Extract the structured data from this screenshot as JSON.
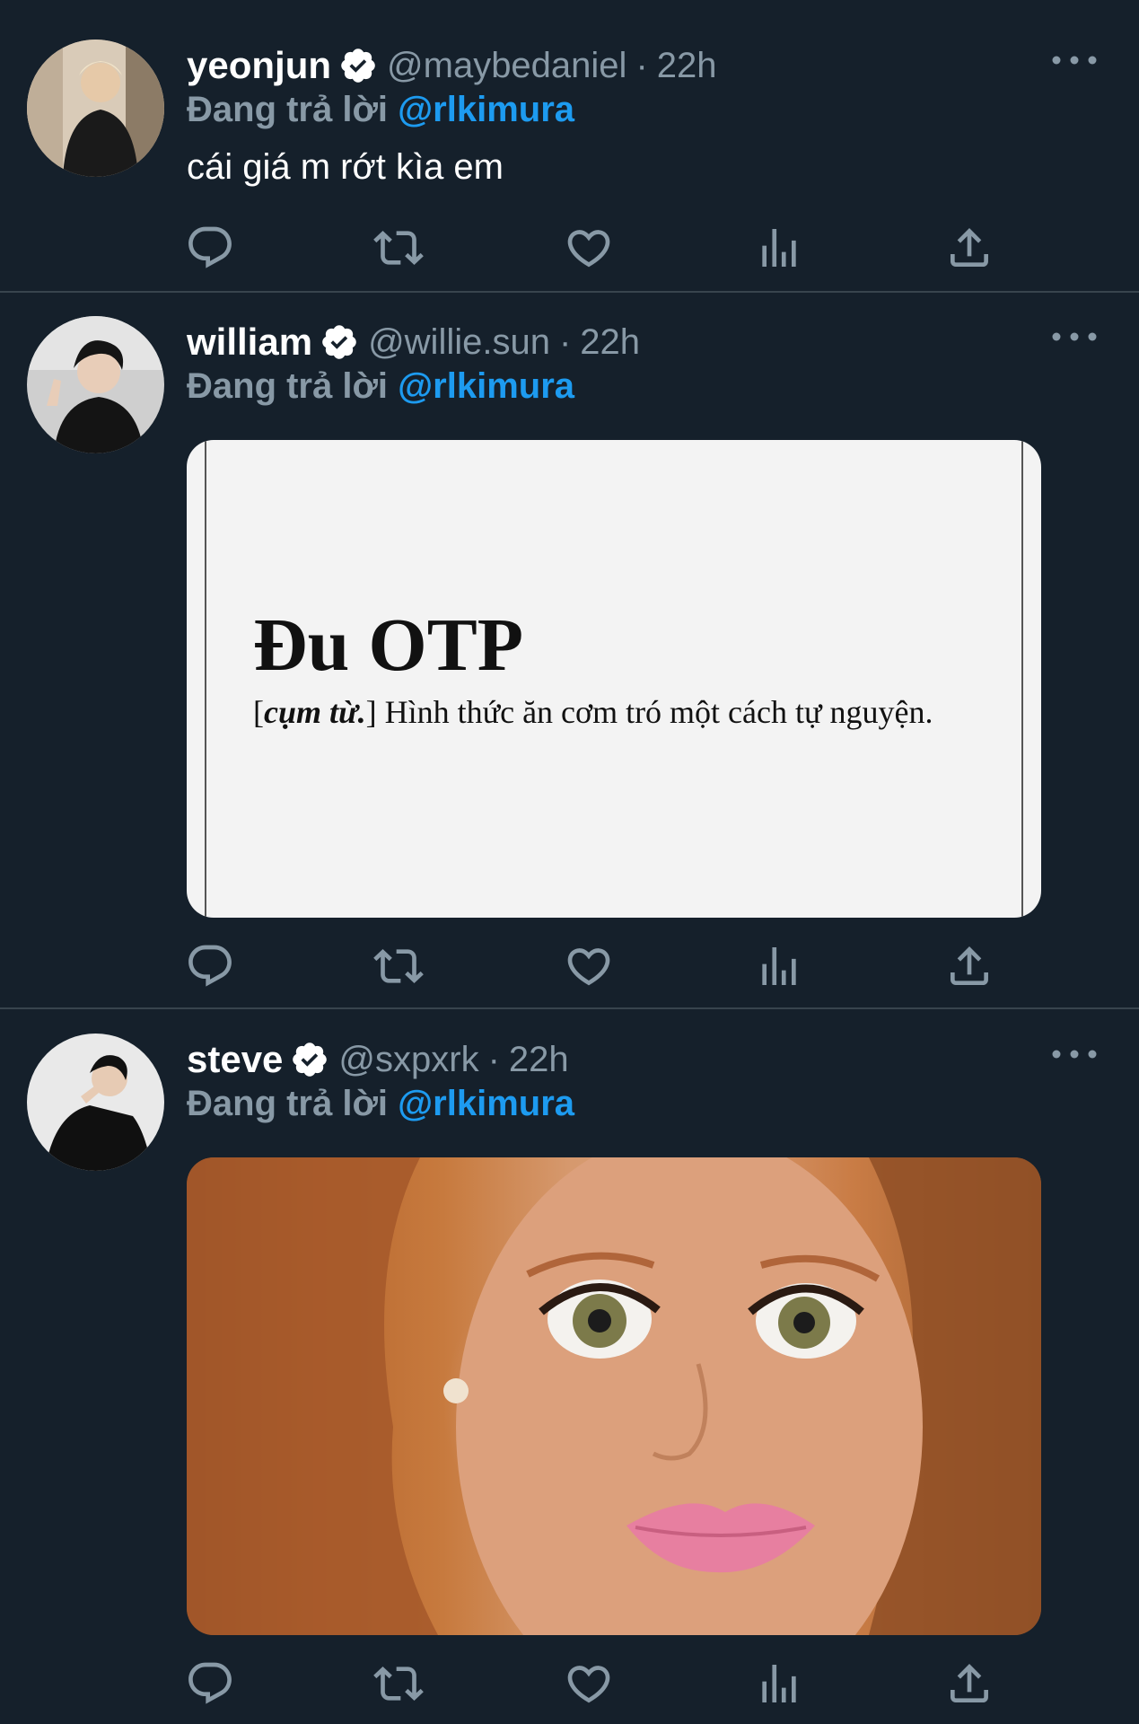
{
  "tweets": [
    {
      "display_name": "yeonjun",
      "handle": "@maybedaniel",
      "separator": "·",
      "time": "22h",
      "replying_label": "Đang trả lời",
      "replying_to": "@rlkimura",
      "text": "cái giá m rớt kìa em"
    },
    {
      "display_name": "william",
      "handle": "@willie.sun",
      "separator": "·",
      "time": "22h",
      "replying_label": "Đang trả lời",
      "replying_to": "@rlkimura",
      "image": {
        "headword": "Đu OTP",
        "bracket_open": "[",
        "part_of_speech": "cụm từ.",
        "bracket_close": "]",
        "definition": " Hình thức ăn cơm tró một cách tự nguyện."
      }
    },
    {
      "display_name": "steve",
      "handle": "@sxpxrk",
      "separator": "·",
      "time": "22h",
      "replying_label": "Đang trả lời",
      "replying_to": "@rlkimura",
      "image_icon": "shocked-doll-photo"
    }
  ],
  "action_icons": [
    "reply-icon",
    "retweet-icon",
    "like-icon",
    "views-icon",
    "share-icon"
  ],
  "colors": {
    "background": "#15202b",
    "secondary_text": "#8899a6",
    "mention": "#1d9bf0",
    "divider": "#38444d"
  }
}
